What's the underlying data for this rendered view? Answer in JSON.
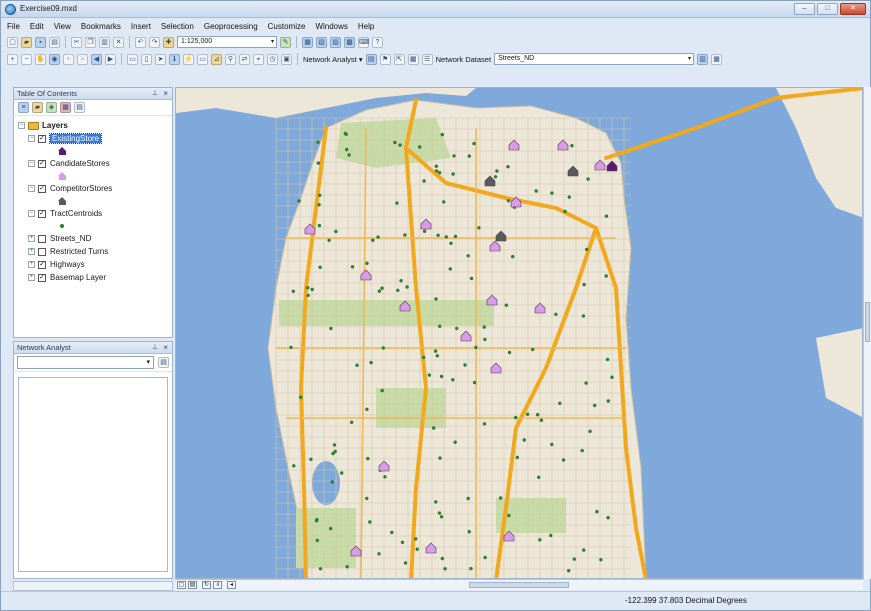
{
  "window": {
    "title": "Exercise09.mxd"
  },
  "menu": [
    "File",
    "Edit",
    "View",
    "Bookmarks",
    "Insert",
    "Selection",
    "Geoprocessing",
    "Customize",
    "Windows",
    "Help"
  ],
  "toolbar": {
    "scale": "1:125,000",
    "network_analyst_label": "Network Analyst ▾",
    "network_dataset_label": "Network Dataset",
    "network_dataset_value": "Streets_ND"
  },
  "toc": {
    "title": "Table Of Contents",
    "group": "Layers",
    "layers": [
      {
        "name": "ExistingStore",
        "checked": true,
        "selected": true,
        "symbol": "house",
        "color": "#5a1a73"
      },
      {
        "name": "CandidateStores",
        "checked": true,
        "symbol": "house",
        "color": "#d99ae8"
      },
      {
        "name": "CompetitorStores",
        "checked": true,
        "symbol": "house",
        "color": "#5a5a5a"
      },
      {
        "name": "TractCentroids",
        "checked": true,
        "symbol": "dot",
        "color": "#2e7d32"
      },
      {
        "name": "Streets_ND",
        "checked": false
      },
      {
        "name": "Restricted Turns",
        "checked": false
      },
      {
        "name": "Highways",
        "checked": true
      },
      {
        "name": "Basemap Layer",
        "checked": true
      }
    ]
  },
  "network_analyst": {
    "title": "Network Analyst"
  },
  "status": {
    "coordinates": "-122.399  37.803 Decimal Degrees"
  },
  "colors": {
    "water": "#7fa9da",
    "land": "#ede7d9",
    "park": "#c7dba7",
    "highway": "#f2a81d",
    "candidate": "#d99ae8",
    "existing": "#5a1a73",
    "competitor": "#5a5a5a",
    "centroid": "#2e7d32"
  }
}
